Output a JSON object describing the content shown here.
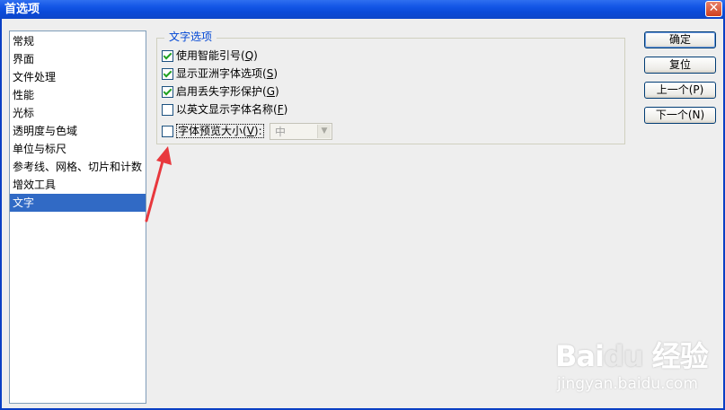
{
  "window": {
    "title": "首选项",
    "close_glyph": "✕"
  },
  "categories": [
    {
      "label": "常规",
      "selected": false
    },
    {
      "label": "界面",
      "selected": false
    },
    {
      "label": "文件处理",
      "selected": false
    },
    {
      "label": "性能",
      "selected": false
    },
    {
      "label": "光标",
      "selected": false
    },
    {
      "label": "透明度与色域",
      "selected": false
    },
    {
      "label": "单位与标尺",
      "selected": false
    },
    {
      "label": "参考线、网格、切片和计数",
      "selected": false
    },
    {
      "label": "增效工具",
      "selected": false
    },
    {
      "label": "文字",
      "selected": true
    }
  ],
  "type_options": {
    "legend": "文字选项",
    "options": [
      {
        "label": "使用智能引号(",
        "key": "Q",
        "close": ")",
        "checked": true
      },
      {
        "label": "显示亚洲字体选项(",
        "key": "S",
        "close": ")",
        "checked": true
      },
      {
        "label": "启用丢失字形保护(",
        "key": "G",
        "close": ")",
        "checked": true
      },
      {
        "label": "以英文显示字体名称(",
        "key": "F",
        "close": ")",
        "checked": false
      },
      {
        "label": "字体预览大小(",
        "key": "V",
        "close": "):",
        "checked": false
      }
    ],
    "preview_size": {
      "value": "中",
      "disabled": true
    }
  },
  "buttons": {
    "ok": "确定",
    "reset": "复位",
    "prev": "上一个(P)",
    "next": "下一个(N)"
  },
  "watermark": {
    "logo": "Bai du 经验",
    "url": "jingyan.baidu.com"
  },
  "colors": {
    "title_bar": "#0a4ad8",
    "selection": "#316ac5",
    "legend_text": "#0046d5",
    "arrow": "#e8383d"
  }
}
